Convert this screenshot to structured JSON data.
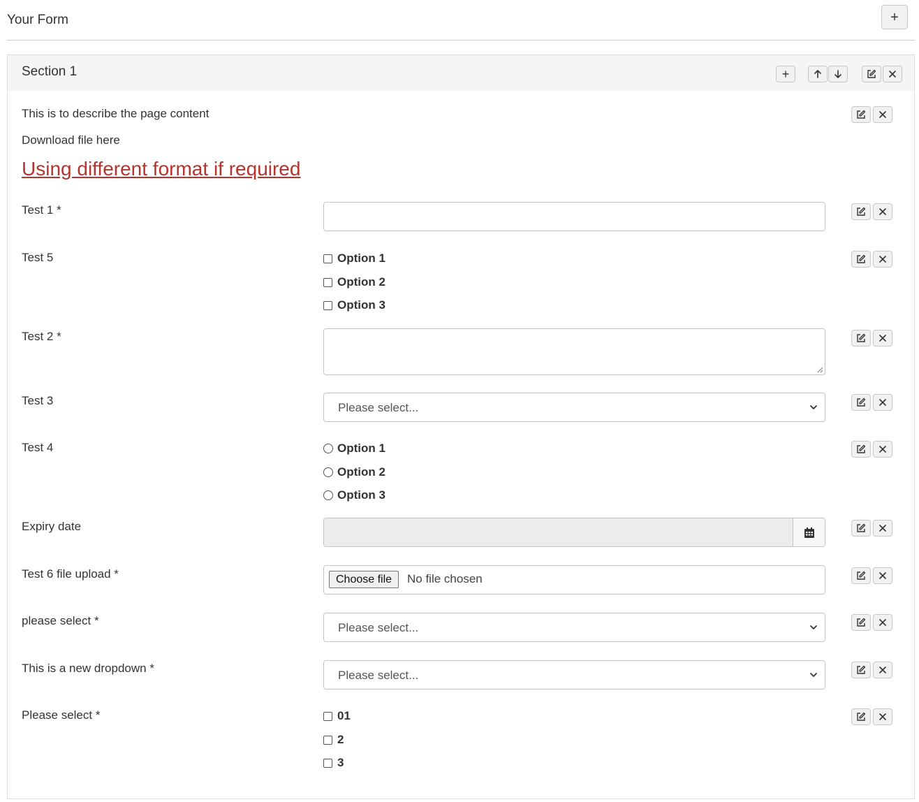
{
  "header": {
    "title": "Your Form",
    "add_button": "+"
  },
  "section": {
    "title": "Section 1",
    "add_button": "+",
    "description": "This is to describe the page content",
    "download_text": "Download file here",
    "link_text": "Using different format if required"
  },
  "fields": {
    "test1": {
      "label": "Test 1 *"
    },
    "test5": {
      "label": "Test 5",
      "options": [
        "Option 1",
        "Option 2",
        "Option 3"
      ]
    },
    "test2": {
      "label": "Test 2 *"
    },
    "test3": {
      "label": "Test 3",
      "placeholder": "Please select..."
    },
    "test4": {
      "label": "Test 4",
      "options": [
        "Option 1",
        "Option 2",
        "Option 3"
      ]
    },
    "expiry": {
      "label": "Expiry date"
    },
    "test6": {
      "label": "Test 6 file upload *",
      "button": "Choose file",
      "status": "No file chosen"
    },
    "select_a": {
      "label": "please select *",
      "placeholder": "Please select..."
    },
    "new_dropdown": {
      "label": "This is a new dropdown *",
      "placeholder": "Please select..."
    },
    "select_b": {
      "label": "Please select *",
      "options": [
        "01",
        "2",
        "3"
      ]
    }
  },
  "colors": {
    "link": "#b4352e",
    "section_header_bg": "#f5f5f5",
    "disabled_bg": "#ececec"
  },
  "icons": {
    "edit": "pencil-square-icon",
    "delete": "close-icon",
    "up": "arrow-up-icon",
    "down": "arrow-down-icon",
    "calendar": "calendar-icon",
    "chevron": "chevron-down-icon"
  }
}
